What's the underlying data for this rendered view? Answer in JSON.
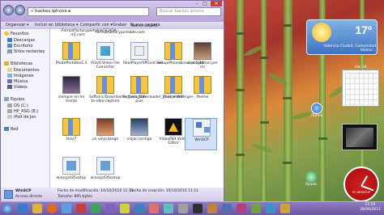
{
  "window": {
    "address": "« backes iphone ▸",
    "search_placeholder": "Buscar backes iphone",
    "toolbar": {
      "organize": "Organizar ▾",
      "include": "Incluir en biblioteca ▾",
      "share": "Compartir con ▾",
      "burn": "Grabar",
      "new_folder": "Nueva carpeta"
    }
  },
  "sidebar": {
    "items": [
      {
        "label": "Favoritos",
        "icon": "star-icon"
      },
      {
        "label": "Descargas",
        "icon": "download-icon"
      },
      {
        "label": "Escritorio",
        "icon": "desktop-icon"
      },
      {
        "label": "Sitios recientes",
        "icon": "recent-icon"
      },
      {
        "label": "Bibliotecas",
        "icon": "library-icon"
      },
      {
        "label": "Documentos",
        "icon": "documents-icon"
      },
      {
        "label": "Imágenes",
        "icon": "pictures-icon"
      },
      {
        "label": "Música",
        "icon": "music-icon"
      },
      {
        "label": "Vídeos",
        "icon": "videos-icon"
      },
      {
        "label": "Equipo",
        "icon": "computer-icon"
      },
      {
        "label": "OS (C:)",
        "icon": "drive-icon"
      },
      {
        "label": "HP_RSG (E:)",
        "icon": "drive-icon"
      },
      {
        "label": "iPod de Jon",
        "icon": "ipod-icon"
      },
      {
        "label": "Red",
        "icon": "network-icon"
      }
    ]
  },
  "files": [
    {
      "label": "",
      "kind": "zip"
    },
    {
      "label": "",
      "kind": "zip"
    },
    {
      "label": "",
      "kind": "zip"
    },
    {
      "label": "",
      "kind": "zip"
    },
    {
      "label": "",
      "kind": "zip"
    },
    {
      "label": "PhotoPortable1.3",
      "kind": "zip"
    },
    {
      "label": "Prism Video File Converter",
      "kind": "exe"
    },
    {
      "label": "RealPlayerSPGold.exe",
      "kind": "exe"
    },
    {
      "label": "SetupiPhoneBrowser.1.40",
      "kind": "zip"
    },
    {
      "label": "si preguntan por mi",
      "kind": "photo"
    },
    {
      "label": "siempre en mi mente",
      "kind": "photo"
    },
    {
      "label": "Softonic/Downloader_para_pdf-to-ideo-capture",
      "kind": "zip"
    },
    {
      "label": "Softonic/Downloader_para_messenger-plus",
      "kind": "zip"
    },
    {
      "label": "Theme Wifi",
      "kind": "zip"
    },
    {
      "label": "theme",
      "kind": "zip"
    },
    {
      "label": "thes7",
      "kind": "zip"
    },
    {
      "label": "un viejo tango",
      "kind": "photo"
    },
    {
      "label": "viajar contigo",
      "kind": "photo"
    },
    {
      "label": "VideoPad Video Editor",
      "kind": "exe"
    },
    {
      "label": "WinSCP",
      "kind": "exe"
    },
    {
      "label": "winscp435setup",
      "kind": "exe"
    },
    {
      "label": "winscp435setup",
      "kind": "exe"
    }
  ],
  "top_labels": [
    "Formatfactoryportable[SCADA-m].com",
    "formatfactoryportable.com",
    "Nueva carpeta"
  ],
  "details": {
    "name": "WinSCP",
    "type": "Acceso directo",
    "modified": "Fecha de modificación: 10/10/2010 11:11",
    "created": "Fecha de creación: 10/10/2010 11:11",
    "size": "Tamaño: 895 bytes"
  },
  "weather": {
    "temp": "17º",
    "city": "Valencia Ciudad, Comunidad Valenc..."
  },
  "calendar": {
    "date_label": "mar 28"
  },
  "clock": {
    "label": "PC-DESKTOP"
  },
  "desktop_icons": [
    {
      "label": "iTunes"
    },
    {
      "label": "Ayuda"
    }
  ],
  "tray": {
    "time": "11:05",
    "date": "28/06/2011"
  },
  "colors": {
    "window": "#c3b2df",
    "taskbar": "#6b58a0",
    "clock": "#c81616"
  }
}
